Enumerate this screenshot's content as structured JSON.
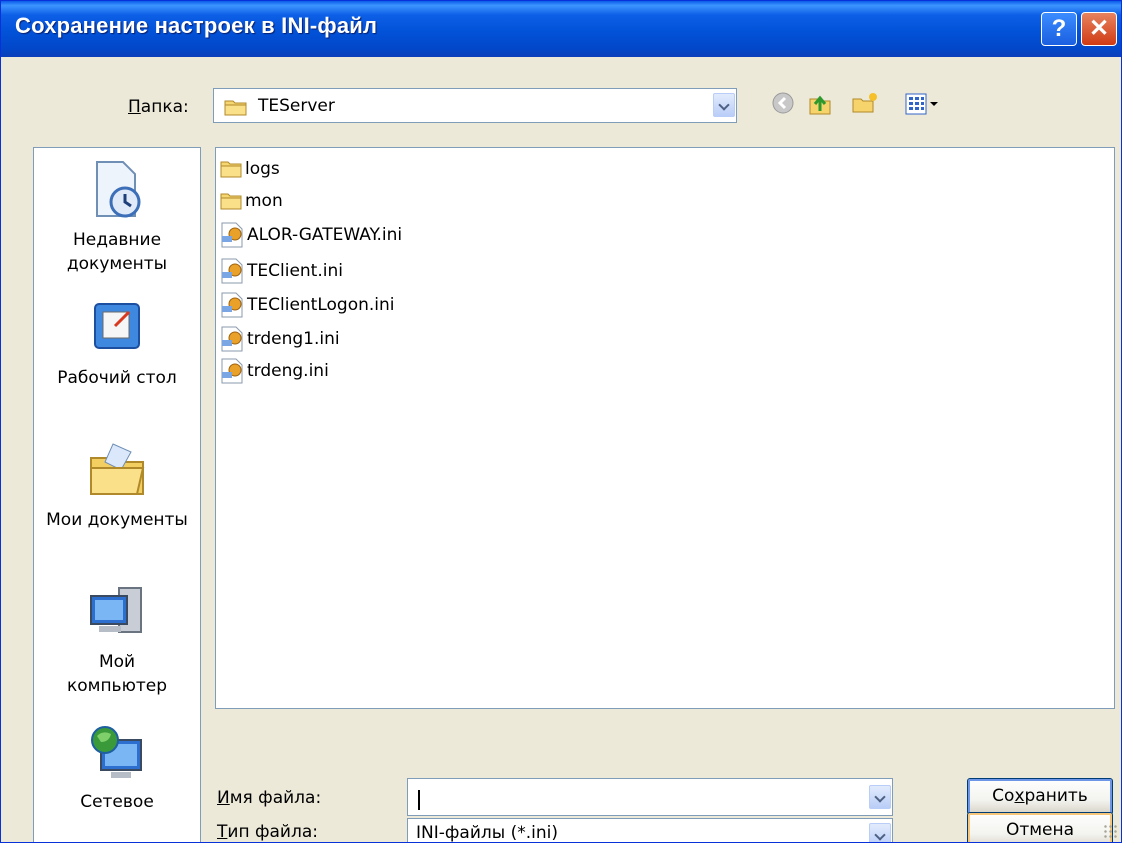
{
  "window": {
    "title": "Сохранение настроек в INI-файл"
  },
  "titlebar": {
    "help_label": "?",
    "close_label": "✕"
  },
  "folder": {
    "label_prefix": "",
    "label_underlined": "П",
    "label_rest": "апка:",
    "value": "TEServer"
  },
  "toolbar": {
    "icons": [
      "back-icon",
      "up-folder-icon",
      "new-folder-icon",
      "view-menu-icon"
    ]
  },
  "places": [
    {
      "line1": "Недавние",
      "line2": "документы",
      "icon": "recent-documents-icon"
    },
    {
      "line1": "Рабочий стол",
      "line2": "",
      "icon": "desktop-icon"
    },
    {
      "line1": "Мои документы",
      "line2": "",
      "icon": "my-documents-icon"
    },
    {
      "line1": "Мой",
      "line2": "компьютер",
      "icon": "my-computer-icon"
    },
    {
      "line1": "Сетевое",
      "line2": "",
      "icon": "network-icon"
    }
  ],
  "files": [
    {
      "name": "logs",
      "type": "folder"
    },
    {
      "name": "mon",
      "type": "folder"
    },
    {
      "name": "ALOR-GATEWAY.ini",
      "type": "ini"
    },
    {
      "name": "TEClient.ini",
      "type": "ini"
    },
    {
      "name": "TEClientLogon.ini",
      "type": "ini"
    },
    {
      "name": "trdeng1.ini",
      "type": "ini"
    },
    {
      "name": "trdeng.ini",
      "type": "ini"
    }
  ],
  "filename": {
    "label_underlined": "И",
    "label_rest": "мя файла:",
    "value": ""
  },
  "filetype": {
    "label_underlined": "Т",
    "label_rest": "ип файла:",
    "value": "INI-файлы (*.ini)"
  },
  "buttons": {
    "save_pre": "Со",
    "save_underlined": "х",
    "save_post": "ранить",
    "cancel": "Отмена"
  },
  "colors": {
    "titlebar": "#0252d8",
    "dialog_bg": "#ece9d8",
    "border": "#7f9db9"
  }
}
